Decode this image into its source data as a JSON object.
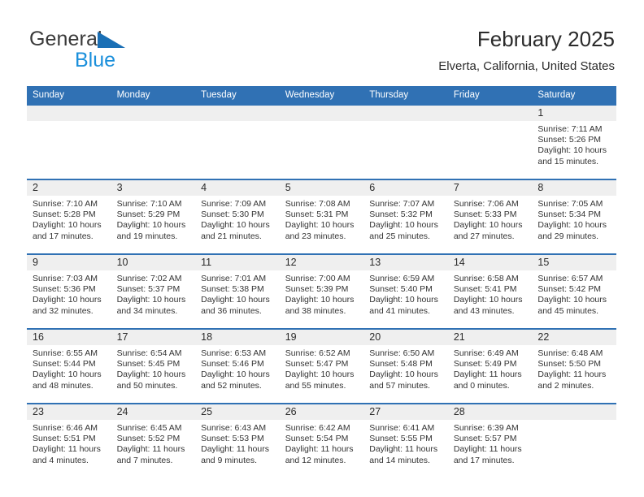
{
  "brand": {
    "word1": "General",
    "word2": "Blue",
    "triangle_color": "#1a6fb5",
    "word2_color": "#1a8fdb"
  },
  "header": {
    "title": "February 2025",
    "subtitle": "Elverta, California, United States"
  },
  "theme": {
    "header_blue": "#3071b4",
    "daynum_band": "#efefef",
    "text": "#2b2b2b"
  },
  "weekdays": [
    "Sunday",
    "Monday",
    "Tuesday",
    "Wednesday",
    "Thursday",
    "Friday",
    "Saturday"
  ],
  "weeks": [
    [
      {
        "day": "",
        "blank": true
      },
      {
        "day": "",
        "blank": true
      },
      {
        "day": "",
        "blank": true
      },
      {
        "day": "",
        "blank": true
      },
      {
        "day": "",
        "blank": true
      },
      {
        "day": "",
        "blank": true
      },
      {
        "day": "1",
        "sunrise": "Sunrise: 7:11 AM",
        "sunset": "Sunset: 5:26 PM",
        "daylight": "Daylight: 10 hours and 15 minutes."
      }
    ],
    [
      {
        "day": "2",
        "sunrise": "Sunrise: 7:10 AM",
        "sunset": "Sunset: 5:28 PM",
        "daylight": "Daylight: 10 hours and 17 minutes."
      },
      {
        "day": "3",
        "sunrise": "Sunrise: 7:10 AM",
        "sunset": "Sunset: 5:29 PM",
        "daylight": "Daylight: 10 hours and 19 minutes."
      },
      {
        "day": "4",
        "sunrise": "Sunrise: 7:09 AM",
        "sunset": "Sunset: 5:30 PM",
        "daylight": "Daylight: 10 hours and 21 minutes."
      },
      {
        "day": "5",
        "sunrise": "Sunrise: 7:08 AM",
        "sunset": "Sunset: 5:31 PM",
        "daylight": "Daylight: 10 hours and 23 minutes."
      },
      {
        "day": "6",
        "sunrise": "Sunrise: 7:07 AM",
        "sunset": "Sunset: 5:32 PM",
        "daylight": "Daylight: 10 hours and 25 minutes."
      },
      {
        "day": "7",
        "sunrise": "Sunrise: 7:06 AM",
        "sunset": "Sunset: 5:33 PM",
        "daylight": "Daylight: 10 hours and 27 minutes."
      },
      {
        "day": "8",
        "sunrise": "Sunrise: 7:05 AM",
        "sunset": "Sunset: 5:34 PM",
        "daylight": "Daylight: 10 hours and 29 minutes."
      }
    ],
    [
      {
        "day": "9",
        "sunrise": "Sunrise: 7:03 AM",
        "sunset": "Sunset: 5:36 PM",
        "daylight": "Daylight: 10 hours and 32 minutes."
      },
      {
        "day": "10",
        "sunrise": "Sunrise: 7:02 AM",
        "sunset": "Sunset: 5:37 PM",
        "daylight": "Daylight: 10 hours and 34 minutes."
      },
      {
        "day": "11",
        "sunrise": "Sunrise: 7:01 AM",
        "sunset": "Sunset: 5:38 PM",
        "daylight": "Daylight: 10 hours and 36 minutes."
      },
      {
        "day": "12",
        "sunrise": "Sunrise: 7:00 AM",
        "sunset": "Sunset: 5:39 PM",
        "daylight": "Daylight: 10 hours and 38 minutes."
      },
      {
        "day": "13",
        "sunrise": "Sunrise: 6:59 AM",
        "sunset": "Sunset: 5:40 PM",
        "daylight": "Daylight: 10 hours and 41 minutes."
      },
      {
        "day": "14",
        "sunrise": "Sunrise: 6:58 AM",
        "sunset": "Sunset: 5:41 PM",
        "daylight": "Daylight: 10 hours and 43 minutes."
      },
      {
        "day": "15",
        "sunrise": "Sunrise: 6:57 AM",
        "sunset": "Sunset: 5:42 PM",
        "daylight": "Daylight: 10 hours and 45 minutes."
      }
    ],
    [
      {
        "day": "16",
        "sunrise": "Sunrise: 6:55 AM",
        "sunset": "Sunset: 5:44 PM",
        "daylight": "Daylight: 10 hours and 48 minutes."
      },
      {
        "day": "17",
        "sunrise": "Sunrise: 6:54 AM",
        "sunset": "Sunset: 5:45 PM",
        "daylight": "Daylight: 10 hours and 50 minutes."
      },
      {
        "day": "18",
        "sunrise": "Sunrise: 6:53 AM",
        "sunset": "Sunset: 5:46 PM",
        "daylight": "Daylight: 10 hours and 52 minutes."
      },
      {
        "day": "19",
        "sunrise": "Sunrise: 6:52 AM",
        "sunset": "Sunset: 5:47 PM",
        "daylight": "Daylight: 10 hours and 55 minutes."
      },
      {
        "day": "20",
        "sunrise": "Sunrise: 6:50 AM",
        "sunset": "Sunset: 5:48 PM",
        "daylight": "Daylight: 10 hours and 57 minutes."
      },
      {
        "day": "21",
        "sunrise": "Sunrise: 6:49 AM",
        "sunset": "Sunset: 5:49 PM",
        "daylight": "Daylight: 11 hours and 0 minutes."
      },
      {
        "day": "22",
        "sunrise": "Sunrise: 6:48 AM",
        "sunset": "Sunset: 5:50 PM",
        "daylight": "Daylight: 11 hours and 2 minutes."
      }
    ],
    [
      {
        "day": "23",
        "sunrise": "Sunrise: 6:46 AM",
        "sunset": "Sunset: 5:51 PM",
        "daylight": "Daylight: 11 hours and 4 minutes."
      },
      {
        "day": "24",
        "sunrise": "Sunrise: 6:45 AM",
        "sunset": "Sunset: 5:52 PM",
        "daylight": "Daylight: 11 hours and 7 minutes."
      },
      {
        "day": "25",
        "sunrise": "Sunrise: 6:43 AM",
        "sunset": "Sunset: 5:53 PM",
        "daylight": "Daylight: 11 hours and 9 minutes."
      },
      {
        "day": "26",
        "sunrise": "Sunrise: 6:42 AM",
        "sunset": "Sunset: 5:54 PM",
        "daylight": "Daylight: 11 hours and 12 minutes."
      },
      {
        "day": "27",
        "sunrise": "Sunrise: 6:41 AM",
        "sunset": "Sunset: 5:55 PM",
        "daylight": "Daylight: 11 hours and 14 minutes."
      },
      {
        "day": "28",
        "sunrise": "Sunrise: 6:39 AM",
        "sunset": "Sunset: 5:57 PM",
        "daylight": "Daylight: 11 hours and 17 minutes."
      },
      {
        "day": "",
        "blank": true
      }
    ]
  ]
}
